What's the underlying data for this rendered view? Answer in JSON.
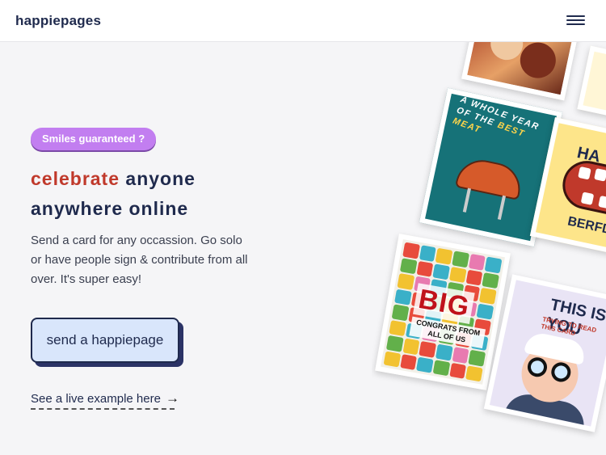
{
  "header": {
    "logo": "happiepages",
    "menu_icon": "hamburger-menu-icon"
  },
  "hero": {
    "badge": "Smiles guaranteed ?",
    "headline_accent": "celebrate",
    "headline_rest_line1": " anyone",
    "headline_line2": "anywhere online",
    "subtext": "Send a card for any occassion. Go solo or have people sign & contribute from all over. It's super easy!",
    "cta_label": "send a happiepage",
    "live_example_label": "See a live example here",
    "arrow_icon": "arrow-right-icon"
  },
  "cards": {
    "bbq_text_a": "A WHOLE YEAR OF THE ",
    "bbq_text_b": "BEST MEAT",
    "teeth_text_top": "HA",
    "teeth_text_bottom": "BERFD",
    "big_word": "BIG",
    "big_subtext": "CONGRATS FROM ALL OF US",
    "glasses_title": "THIS IS YOU",
    "glasses_subtitle": "TRYING TO READ THIS CARD"
  },
  "colors": {
    "accent_red": "#c0392b",
    "navy": "#1f2a4d",
    "badge_purple": "#c27ef0",
    "cta_bg": "#d9e6fb"
  }
}
